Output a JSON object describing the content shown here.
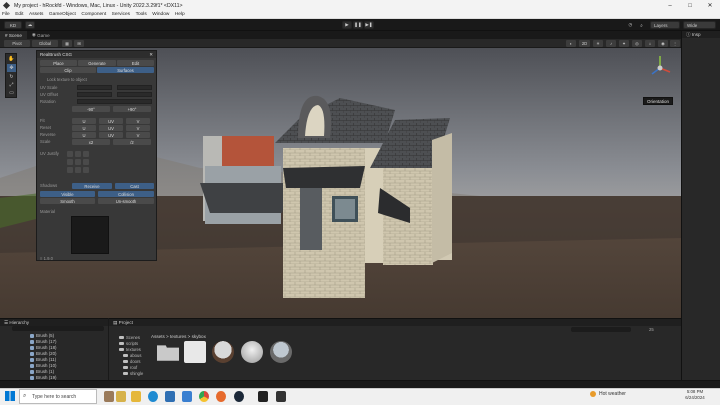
{
  "window": {
    "title": "My project - hRockfd - Windows, Mac, Linux - Unity 2022.3.29f1* <DX11>"
  },
  "menu": [
    "File",
    "Edit",
    "Assets",
    "GameObject",
    "Component",
    "Services",
    "Tools",
    "Window",
    "Help"
  ],
  "toolbar": {
    "account_label": "KD",
    "layers_label": "Layers",
    "layout_label": "Wide"
  },
  "scene_tabs": [
    "Scene",
    "Game"
  ],
  "scene_bar": {
    "pivot": "Pivot",
    "global": "Global",
    "persp_label": "Persp",
    "mode_2d": "2D"
  },
  "orientation_tooltip": "Orientation",
  "probuilder": {
    "title": "RealBrush CSG",
    "modes": [
      "Place",
      "Generate",
      "Edit"
    ],
    "submodes": [
      "Clip",
      "Surfaces"
    ],
    "hint": "Lock texture to object",
    "uv_scale": "UV Scale",
    "uv_offset": "UV Offset",
    "rotation": "Rotation",
    "rot_left": "-90°",
    "rot_right": "+90°",
    "fit": "Fit",
    "reset": "Reset",
    "reverse": "Reverse",
    "scale": "Scale",
    "scale_half": "x2",
    "scale_div": "/2",
    "uv_justify": "UV Justify",
    "u": "U",
    "v": "V",
    "uv": "UV",
    "shadows": "Shadows",
    "receive": "Receive",
    "cast": "Cast",
    "visible": "Visible",
    "collision": "Collision",
    "smooth": "Smooth",
    "un_smooth": "Un-smooth",
    "material": "Material",
    "footer": "≡ 1.9.0"
  },
  "hierarchy": {
    "title": "Hierarchy",
    "items": [
      "Brush (5)",
      "Brush (17)",
      "Brush (18)",
      "Brush (20)",
      "Brush (11)",
      "Brush (10)",
      "Brush (1)",
      "Brush (19)"
    ]
  },
  "project": {
    "title": "Project",
    "breadcrumb": "Assets > textures > skybox",
    "folders": [
      "Scenes",
      "scripts",
      "textures",
      "abous",
      "doors",
      "roof",
      "shingle"
    ],
    "asset_count": "25"
  },
  "taskbar": {
    "search_placeholder": "Type here to search",
    "weather": "Hot weather",
    "time": "5:08 PM",
    "date": "6/24/2024"
  }
}
